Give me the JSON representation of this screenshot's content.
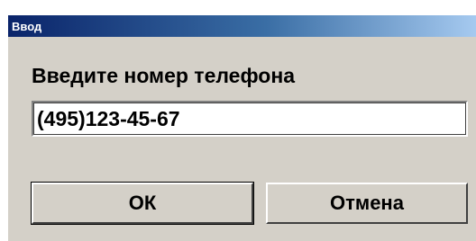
{
  "window": {
    "title": "Ввод"
  },
  "dialog": {
    "prompt": "Введите номер телефона",
    "phone_value": "(495)123-45-67",
    "ok_label": "ОК",
    "cancel_label": "Отмена"
  },
  "colors": {
    "titlebar_start": "#0a246a",
    "titlebar_end": "#a6caf0",
    "dialog_bg": "#d4d0c8"
  }
}
